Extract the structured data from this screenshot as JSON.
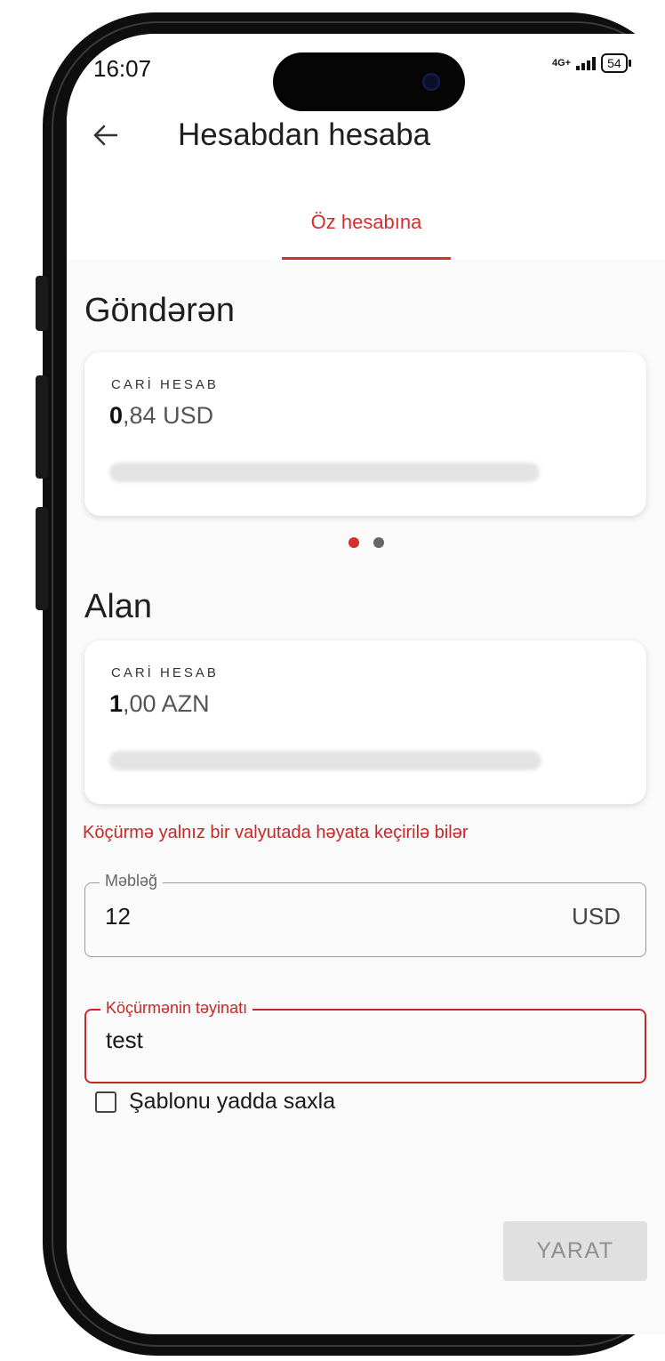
{
  "status_bar": {
    "time": "16:07",
    "network": "4G+",
    "battery": "54"
  },
  "header": {
    "back_icon": "arrow-left-icon",
    "title": "Hesabdan hesaba"
  },
  "tabs": [
    {
      "label": "Öz hesabına",
      "active": true
    }
  ],
  "sender": {
    "section_title": "Göndərən",
    "account_type": "CARİ HESAB",
    "balance_whole": "0",
    "balance_rest": ",84 USD",
    "dots": {
      "count": 2,
      "active_index": 0
    }
  },
  "receiver": {
    "section_title": "Alan",
    "account_type": "CARİ HESAB",
    "balance_whole": "1",
    "balance_rest": ",00 AZN"
  },
  "error_message": "Köçürmə yalnız bir valyutada həyata keçirilə bilər",
  "amount_field": {
    "label": "Məbləğ",
    "value": "12",
    "currency": "USD"
  },
  "purpose_field": {
    "label": "Köçürmənin təyinatı",
    "value": "test"
  },
  "save_template": {
    "label": "Şablonu yadda saxla",
    "checked": false
  },
  "submit_button": {
    "label": "YARAT",
    "enabled": false
  },
  "colors": {
    "accent": "#d32f2f",
    "error": "#c62828",
    "disabled_bg": "#e0e0e0",
    "disabled_text": "#8f8f8f",
    "screen_bg": "#fafafa"
  }
}
